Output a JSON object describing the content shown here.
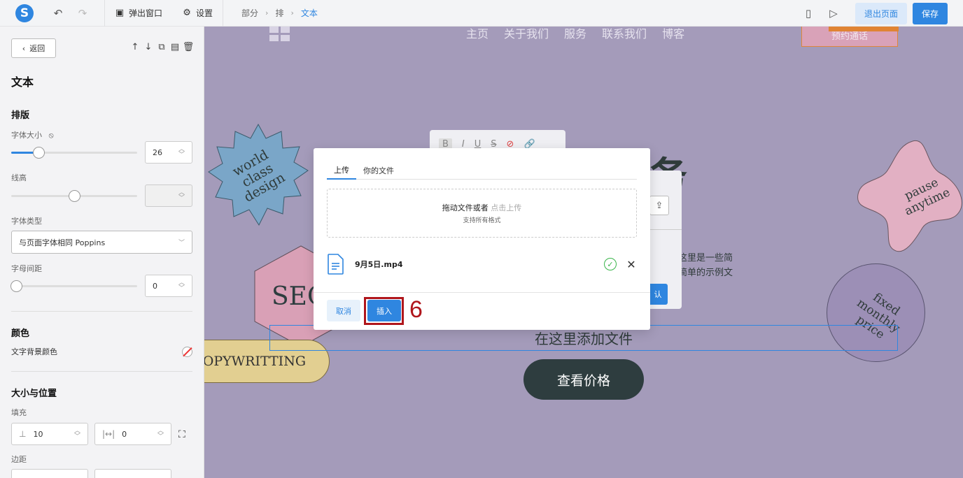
{
  "toolbar": {
    "logo_letter": "S",
    "popup_label": "弹出窗口",
    "settings_label": "设置",
    "breadcrumb": [
      "部分",
      "排",
      "文本"
    ],
    "exit_label": "退出页面",
    "save_label": "保存"
  },
  "panel": {
    "back_label": "返回",
    "title": "文本",
    "typography_heading": "排版",
    "font_size_label": "字体大小",
    "font_size_value": "26",
    "line_height_label": "线高",
    "line_height_value": "",
    "font_type_label": "字体类型",
    "font_type_value": "与页面字体相同 Poppins",
    "letter_spacing_label": "字母间距",
    "letter_spacing_value": "0",
    "color_heading": "颜色",
    "text_bg_color_label": "文字背景颜色",
    "size_position_heading": "大小与位置",
    "padding_label": "填充",
    "padding_vertical": "10",
    "padding_horizontal": "0",
    "margin_label": "边距"
  },
  "canvas": {
    "nav": [
      "主页",
      "关于我们",
      "服务",
      "联系我们",
      "博客"
    ],
    "top_cta": "预约通话",
    "heading": "务",
    "desc_line1": "息这里是一些简",
    "desc_line2": "些简单的示例文",
    "add_file_text": "在这里添加文件",
    "price_button": "查看价格",
    "copywriting": "COPYWRITTING",
    "seo": "SEO",
    "badge_star": [
      "world",
      "class",
      "design"
    ],
    "badge_blob": [
      "pause",
      "anytime"
    ],
    "badge_circle": [
      "fixed",
      "monthly",
      "price"
    ],
    "bg_confirm": "认"
  },
  "modal": {
    "tab_upload": "上传",
    "tab_files": "你的文件",
    "drop_main": "拖动文件或者",
    "drop_hint": "点击上传",
    "drop_sub": "支持所有格式",
    "file_name": "9月5日.mp4",
    "cancel_label": "取消",
    "insert_label": "插入"
  },
  "annotation": {
    "step_number": "6",
    "highlight_color": "#b0161c"
  },
  "colors": {
    "accent": "#2f86e0",
    "canvas_bg": "#a49bba"
  }
}
